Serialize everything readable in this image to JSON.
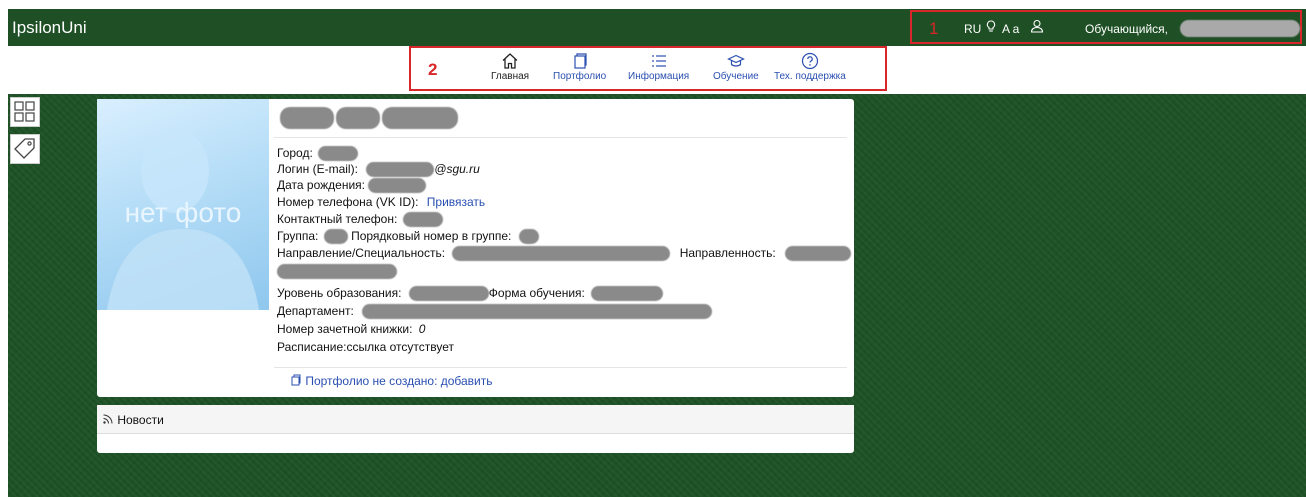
{
  "app": {
    "title": "IpsilonUni"
  },
  "topbar": {
    "annotation": "1",
    "lang": "RU",
    "font_size": "A a",
    "role_label": "Обучающийся,",
    "icons": [
      "lightbulb-icon",
      "user-icon"
    ]
  },
  "nav": {
    "annotation": "2",
    "items": [
      {
        "label": "Главная",
        "icon": "home-icon"
      },
      {
        "label": "Портфолио",
        "icon": "portfolio-icon"
      },
      {
        "label": "Информация",
        "icon": "list-icon"
      },
      {
        "label": "Обучение",
        "icon": "graduation-cap-icon"
      },
      {
        "label": "Тех. поддержка",
        "icon": "help-icon"
      }
    ]
  },
  "profile": {
    "photo_text": "нет фото",
    "city_label": "Город:",
    "login_label": "Логин (E-mail):",
    "login_domain": "@sgu.ru",
    "birth_label": "Дата рождения:",
    "phone_vk_label": "Номер телефона (VK ID):",
    "phone_vk_link": "Привязать",
    "contact_phone_label": "Контактный телефон:",
    "group_label": "Группа:",
    "group_order_label": "Порядковый номер в группе:",
    "direction_label": "Направление/Специальность:",
    "focus_label": "Направленность:",
    "edu_level_label": "Уровень образования:",
    "study_form_label": "Форма обучения:",
    "department_label": "Департамент:",
    "record_book_label": "Номер зачетной книжки:",
    "record_book_value": "0",
    "schedule_label": "Расписание:",
    "schedule_value": "ссылка отсутствует",
    "portfolio_link": "Портфолио не создано: добавить"
  },
  "news": {
    "title": "Новости"
  },
  "colors": {
    "topbar": "#1f4f25",
    "accent_link": "#2a4fb0",
    "annotation": "#d8262a",
    "background": "#1e5226"
  }
}
